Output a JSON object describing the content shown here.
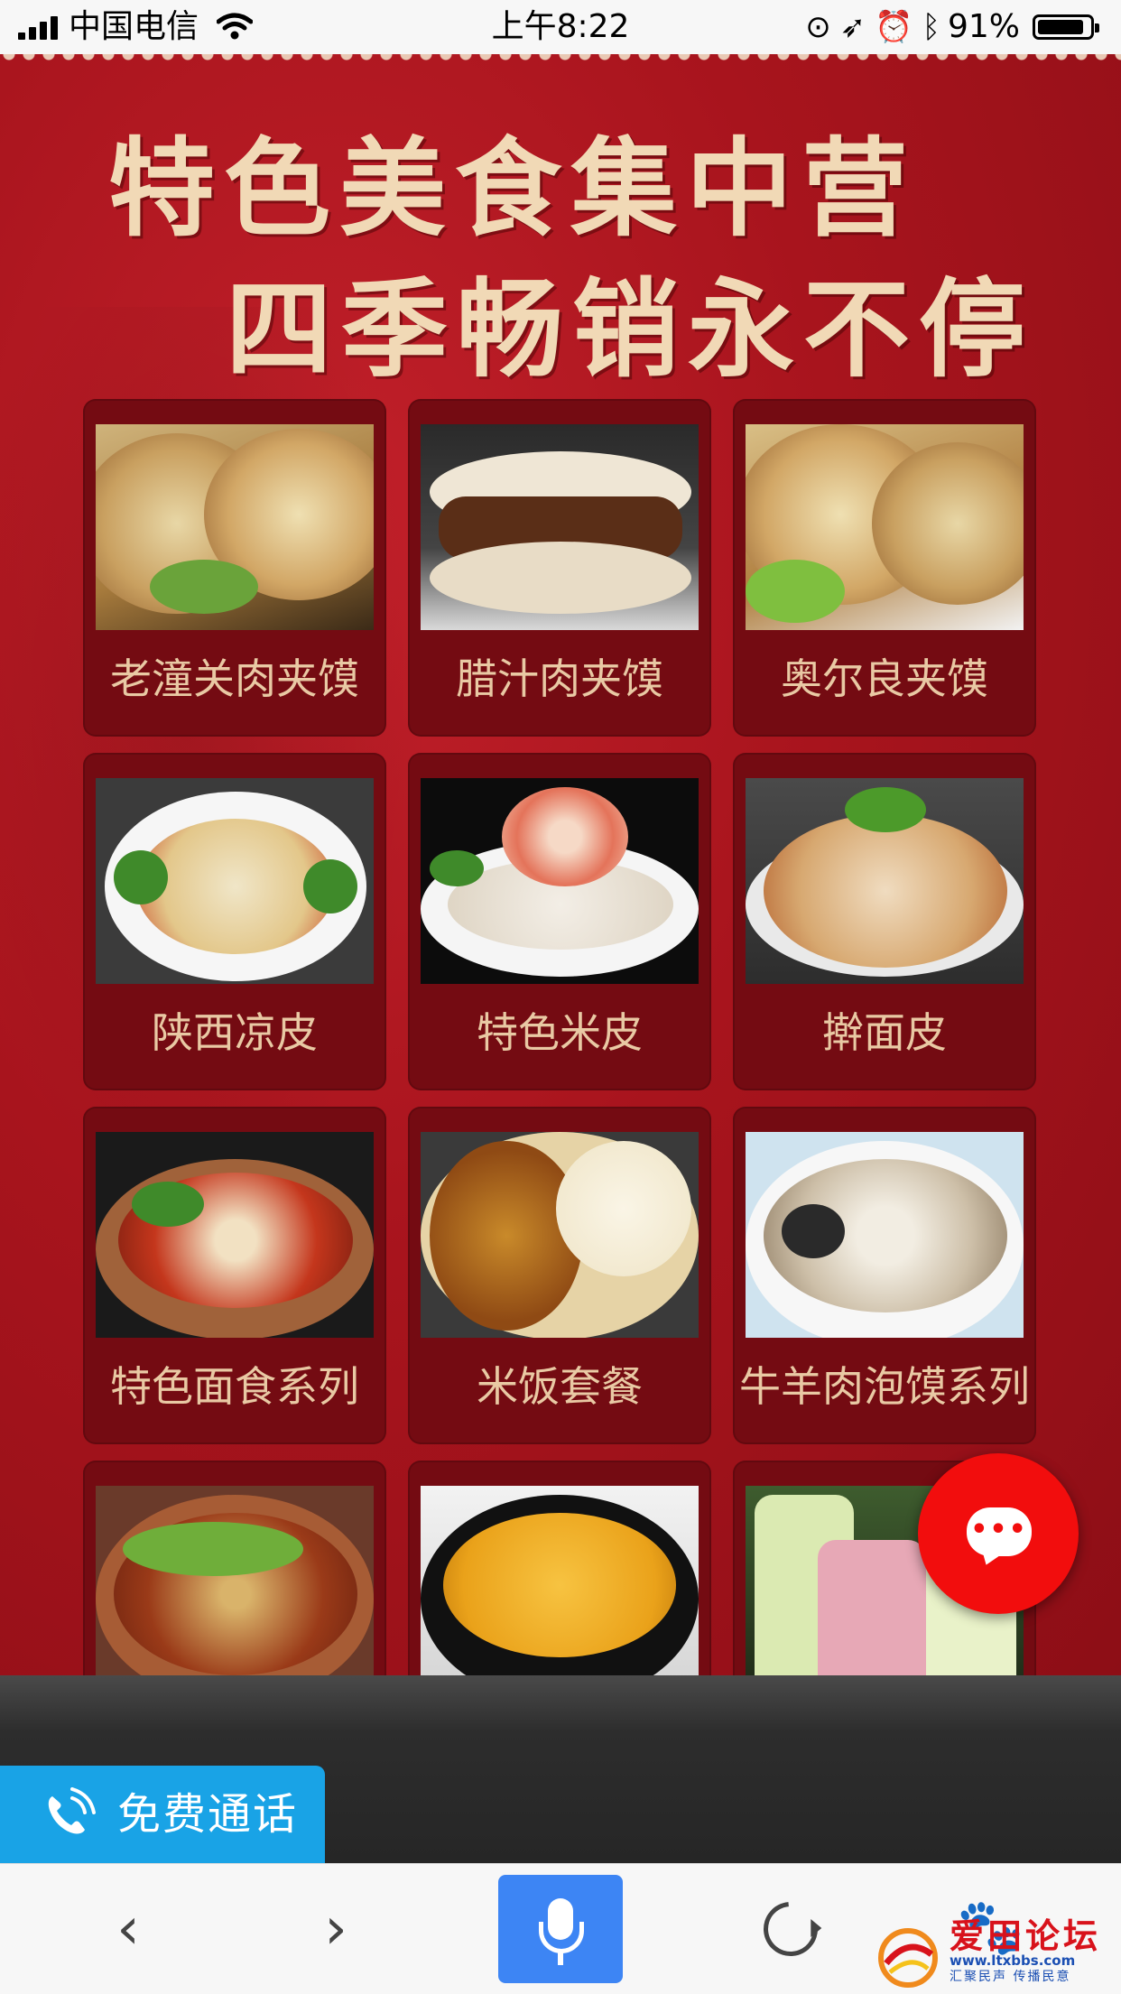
{
  "status_bar": {
    "carrier": "中国电信",
    "time": "上午8:22",
    "battery_percent": "91%",
    "battery_level": 0.91
  },
  "banner": {
    "line1": "特色美食集中营",
    "line2": "四季畅销永不停"
  },
  "menu_items": [
    {
      "label": "老潼关肉夹馍",
      "icon": "flatbread-sandwich-photo"
    },
    {
      "label": "腊汁肉夹馍",
      "icon": "roujiamo-photo"
    },
    {
      "label": "奥尔良夹馍",
      "icon": "flatbread-sandwich-photo"
    },
    {
      "label": "陕西凉皮",
      "icon": "liangpi-photo"
    },
    {
      "label": "特色米皮",
      "icon": "rice-noodle-photo"
    },
    {
      "label": "擀面皮",
      "icon": "ganmianpi-photo"
    },
    {
      "label": "特色面食系列",
      "icon": "noodle-bowl-photo"
    },
    {
      "label": "米饭套餐",
      "icon": "curry-rice-photo"
    },
    {
      "label": "牛羊肉泡馍系列",
      "icon": "paomo-soup-photo"
    },
    {
      "label": "",
      "icon": "spicy-noodles-photo"
    },
    {
      "label": "",
      "icon": "millet-porridge-photo"
    },
    {
      "label": "",
      "icon": "drinks-photo"
    }
  ],
  "actions": {
    "free_call_label": "免费通话"
  },
  "watermark": {
    "title": "爱田论坛",
    "url": "www.ltxbbs.com",
    "slogan": "汇聚民声 传播民意"
  },
  "colors": {
    "background_red": "#a8141d",
    "card": "#740b12",
    "card_text": "#e9c9a4",
    "chat_button": "#f20d0d",
    "call_button": "#19a3e6",
    "mic_button": "#3d85f4"
  }
}
